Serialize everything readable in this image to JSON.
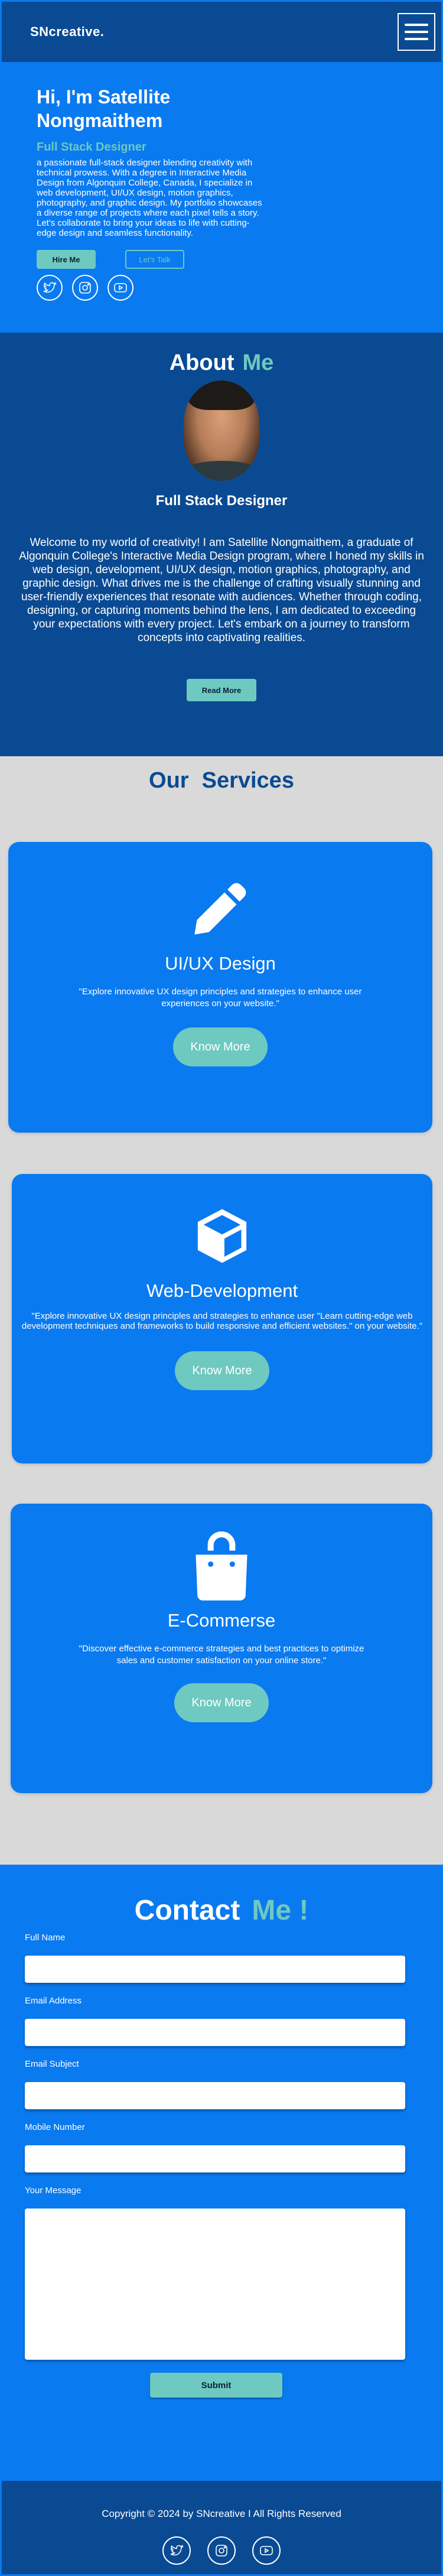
{
  "header": {
    "brand": "SNcreative.",
    "menu_icon": "hamburger-menu-icon"
  },
  "hero": {
    "title": "Hi, I'm Satellite Nongmaithem",
    "role": "Full Stack Designer",
    "description": "a passionate full-stack designer blending creativity with technical prowess. With a degree in Interactive Media Design from Algonquin College, Canada, I specialize in web development, UI/UX design, motion graphics, photography, and graphic design. My portfolio showcases a diverse range of projects where each pixel tells a story. Let's collaborate to bring your ideas to life with cutting-edge design and seamless functionality.",
    "hire_label": "Hire Me",
    "talk_label": "Let's Talk",
    "socials": [
      "twitter-icon",
      "instagram-icon",
      "youtube-icon"
    ]
  },
  "about": {
    "title": "About",
    "title_accent": "Me",
    "role": "Full Stack Designer",
    "text": "Welcome to my world of creativity! I am Satellite Nongmaithem, a graduate of Algonquin College's Interactive Media Design program, where I honed my skills in web design, development, UI/UX design, motion graphics, photography, and graphic design. What drives me is the challenge of crafting visually stunning and user-friendly experiences that resonate with audiences. Whether through coding, designing, or capturing moments behind the lens, I am dedicated to exceeding your expectations with every project. Let's embark on a journey to transform concepts into captivating realities.",
    "read_more_label": "Read More"
  },
  "services": {
    "title": "Our",
    "title_accent": "Services",
    "cards": [
      {
        "icon": "pencil-icon",
        "title": "UI/UX Design",
        "description": "\"Explore innovative UX design principles and strategies to enhance user experiences on your website.\"",
        "button": "Know More"
      },
      {
        "icon": "cube-icon",
        "title": "Web-Development",
        "description": "\"Explore innovative UX design principles and strategies to enhance user \"Learn cutting-edge web development techniques and frameworks to build responsive and efficient websites.\" on your website.\"",
        "button": "Know More"
      },
      {
        "icon": "shopping-bag-icon",
        "title": "E-Commerse",
        "description": "\"Discover effective e-commerce strategies and best practices to optimize sales and customer satisfaction on your online store.\"",
        "button": "Know More"
      }
    ]
  },
  "contact": {
    "title": "Contact",
    "title_accent": "Me !",
    "fields": {
      "full_name": "Full Name",
      "email": "Email Address",
      "subject": "Email Subject",
      "mobile": "Mobile Number",
      "message": "Your Message"
    },
    "submit_label": "Submit"
  },
  "footer": {
    "copyright": "Copyright © 2024 by SNcreative I All Rights Reserved",
    "socials": [
      "twitter-icon",
      "instagram-icon",
      "youtube-icon"
    ]
  },
  "colors": {
    "primary_blue": "#0a7af0",
    "dark_blue": "#0a4a93",
    "accent_teal": "#6ec9c0",
    "background_gray": "#d9d9d9"
  }
}
